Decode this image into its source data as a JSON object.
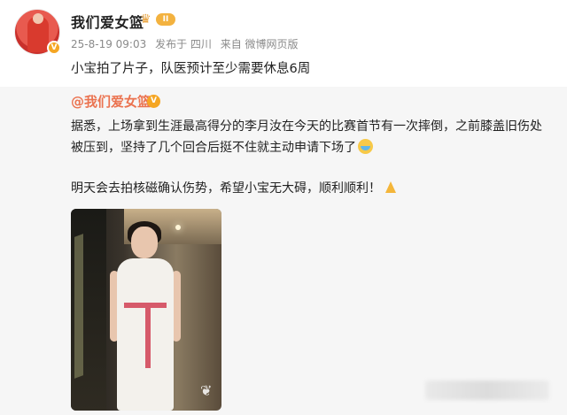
{
  "post": {
    "author": "我们爱女篮",
    "level": "II",
    "date": "25-8-19 09:03",
    "location": "发布于 四川",
    "source": "来自 微博网页版",
    "text": "小宝拍了片子，队医预计至少需要休息6周"
  },
  "repost": {
    "author": "@我们爱女篮",
    "body_line": "据悉，上场拿到生涯最高得分的李月汝在今天的比赛首节有一次摔倒，之前膝盖旧伤处被压到，坚持了几个回合后挺不住就主动申请下场了",
    "body_line2": "明天会去拍核磁确认伤势，希望小宝无大碍，顺利顺利！",
    "emoji1": "cry-emoji",
    "emoji2": "pray-emoji"
  },
  "colors": {
    "author_link": "#eb7350",
    "meta_text": "#8a8a8a",
    "repost_bg": "#f6f6f6",
    "verify_badge": "#f5a623"
  },
  "icons": {
    "avatar": "avatar-image",
    "verify": "verified-badge-icon",
    "crown": "crown-icon",
    "photo": "player-photo"
  }
}
